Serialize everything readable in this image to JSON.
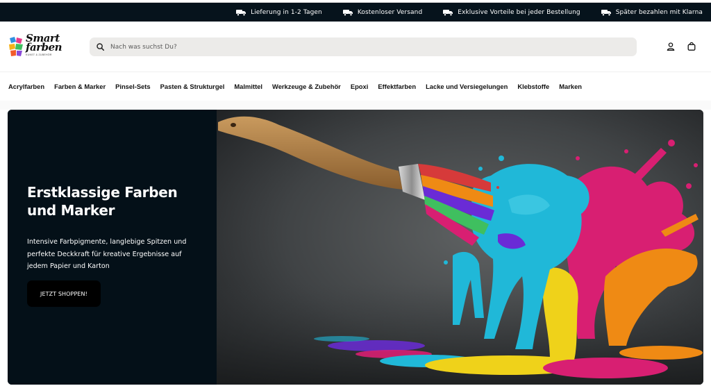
{
  "announcement_bar": {
    "items": [
      {
        "label": "Lieferung in 1-2 Tagen",
        "icon": "truck-icon"
      },
      {
        "label": "Kostenloser Versand",
        "icon": "truck-icon"
      },
      {
        "label": "Exklusive Vorteile bei jeder Bestellung",
        "icon": "truck-icon"
      },
      {
        "label": "Später bezahlen mit Klarna",
        "icon": "truck-icon"
      }
    ]
  },
  "header": {
    "logo_line1": "Smart",
    "logo_line2": "farben",
    "logo_tagline": "KUNST & ZUBEHÖR",
    "search": {
      "placeholder": "Nach was suchst Du?",
      "icon": "search-icon"
    },
    "account_icon": "user-icon",
    "cart_icon": "shopping-bag-icon"
  },
  "nav": {
    "items": [
      "Acrylfarben",
      "Farben & Marker",
      "Pinsel-Sets",
      "Pasten & Strukturgel",
      "Malmittel",
      "Werkzeuge & Zubehör",
      "Epoxi",
      "Effektfarben",
      "Lacke und Versiegelungen",
      "Klebstoffe",
      "Marken"
    ]
  },
  "hero": {
    "title": "Erstklassige Farben und Marker",
    "text": "Intensive Farbpigmente, langlebige Spitzen und perfekte Deckkraft für kreative Ergebnisse auf jedem Papier und Karton",
    "button_label": "JETZT SHOPPEN!"
  },
  "colors": {
    "announcement_bg": "#06131c",
    "hero_panel_bg": "#041018",
    "button_bg": "#000000",
    "search_bg": "#ecebe9",
    "paint_cyan": "#20b8d8",
    "paint_magenta": "#d81f72",
    "paint_orange": "#ef8a14",
    "paint_yellow": "#efd21a",
    "paint_purple": "#6a2bd6"
  }
}
